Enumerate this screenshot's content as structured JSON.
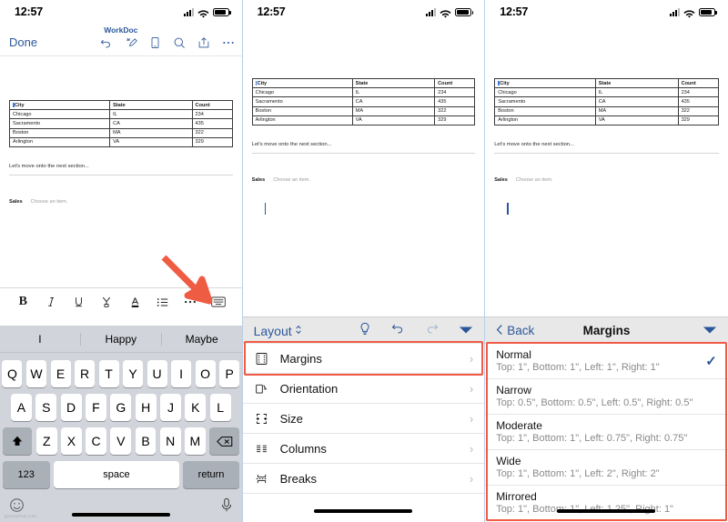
{
  "status": {
    "time": "12:57",
    "signal_icon": "cellular-signal-icon",
    "wifi_icon": "wifi-icon",
    "battery_icon": "battery-icon"
  },
  "panel1": {
    "nav": {
      "done_label": "Done",
      "doc_title": "WorkDoc",
      "icons": [
        "undo-icon",
        "ink-icon",
        "mobile-view-icon",
        "search-icon",
        "share-icon",
        "more-icon"
      ]
    },
    "document": {
      "table": {
        "headers": [
          "City",
          "State",
          "Count"
        ],
        "rows": [
          [
            "Chicago",
            "IL",
            "234"
          ],
          [
            "Sacramento",
            "CA",
            "435"
          ],
          [
            "Boston",
            "MA",
            "322"
          ],
          [
            "Arlington",
            "VA",
            "329"
          ]
        ]
      },
      "paragraph": "Let's move onto the next section...",
      "content_control_label": "Sales",
      "content_control_placeholder": "Choose an item."
    },
    "dictation_icon": "microphone-icon",
    "format_toolbar": [
      "bold-icon",
      "italic-icon",
      "underline-icon",
      "highlight-icon",
      "font-color-icon",
      "bullet-list-icon",
      "more-format-icon",
      "hide-keyboard-icon"
    ],
    "keyboard": {
      "suggestions": [
        "I",
        "Happy",
        "Maybe"
      ],
      "row1": [
        "Q",
        "W",
        "E",
        "R",
        "T",
        "Y",
        "U",
        "I",
        "O",
        "P"
      ],
      "row2": [
        "A",
        "S",
        "D",
        "F",
        "G",
        "H",
        "J",
        "K",
        "L"
      ],
      "row3": [
        "Z",
        "X",
        "C",
        "V",
        "B",
        "N",
        "M"
      ],
      "shift_icon": "shift-icon",
      "backspace_icon": "backspace-icon",
      "numbers_label": "123",
      "space_label": "space",
      "return_label": "return",
      "emoji_icon": "emoji-icon",
      "dictation_icon": "microphone-icon"
    },
    "watermark": "groovyPost.com"
  },
  "panel2": {
    "ribbon": {
      "tab_label": "Layout",
      "tab_caret_icon": "updown-caret-icon",
      "icons": [
        "tell-me-icon",
        "undo-icon",
        "redo-icon",
        "collapse-ribbon-icon"
      ]
    },
    "menu": [
      {
        "label": "Margins",
        "icon": "margins-icon",
        "chevron": "chevron-right-icon",
        "highlighted": true
      },
      {
        "label": "Orientation",
        "icon": "orientation-icon",
        "chevron": "chevron-right-icon",
        "highlighted": false
      },
      {
        "label": "Size",
        "icon": "size-icon",
        "chevron": "chevron-right-icon",
        "highlighted": false
      },
      {
        "label": "Columns",
        "icon": "columns-icon",
        "chevron": "chevron-right-icon",
        "highlighted": false
      },
      {
        "label": "Breaks",
        "icon": "breaks-icon",
        "chevron": "chevron-right-icon",
        "highlighted": false
      }
    ]
  },
  "panel3": {
    "header": {
      "back_label": "Back",
      "back_icon": "chevron-left-icon",
      "title": "Margins",
      "collapse_icon": "collapse-ribbon-icon"
    },
    "options": [
      {
        "title": "Normal",
        "detail": "Top: 1\", Bottom: 1\", Left: 1\", Right: 1\"",
        "selected": true
      },
      {
        "title": "Narrow",
        "detail": "Top: 0.5\", Bottom: 0.5\", Left: 0.5\", Right: 0.5\"",
        "selected": false
      },
      {
        "title": "Moderate",
        "detail": "Top: 1\", Bottom: 1\", Left: 0.75\", Right: 0.75\"",
        "selected": false
      },
      {
        "title": "Wide",
        "detail": "Top: 1\", Bottom: 1\", Left: 2\", Right: 2\"",
        "selected": false
      },
      {
        "title": "Mirrored",
        "detail": "Top: 1\", Bottom: 1\", Left: 1.25\", Right: 1\"",
        "selected": false
      }
    ],
    "check_icon": "checkmark-icon"
  },
  "colors": {
    "accent": "#2b579a",
    "highlight": "#ef5b45",
    "arrow": "#ee5c44"
  }
}
